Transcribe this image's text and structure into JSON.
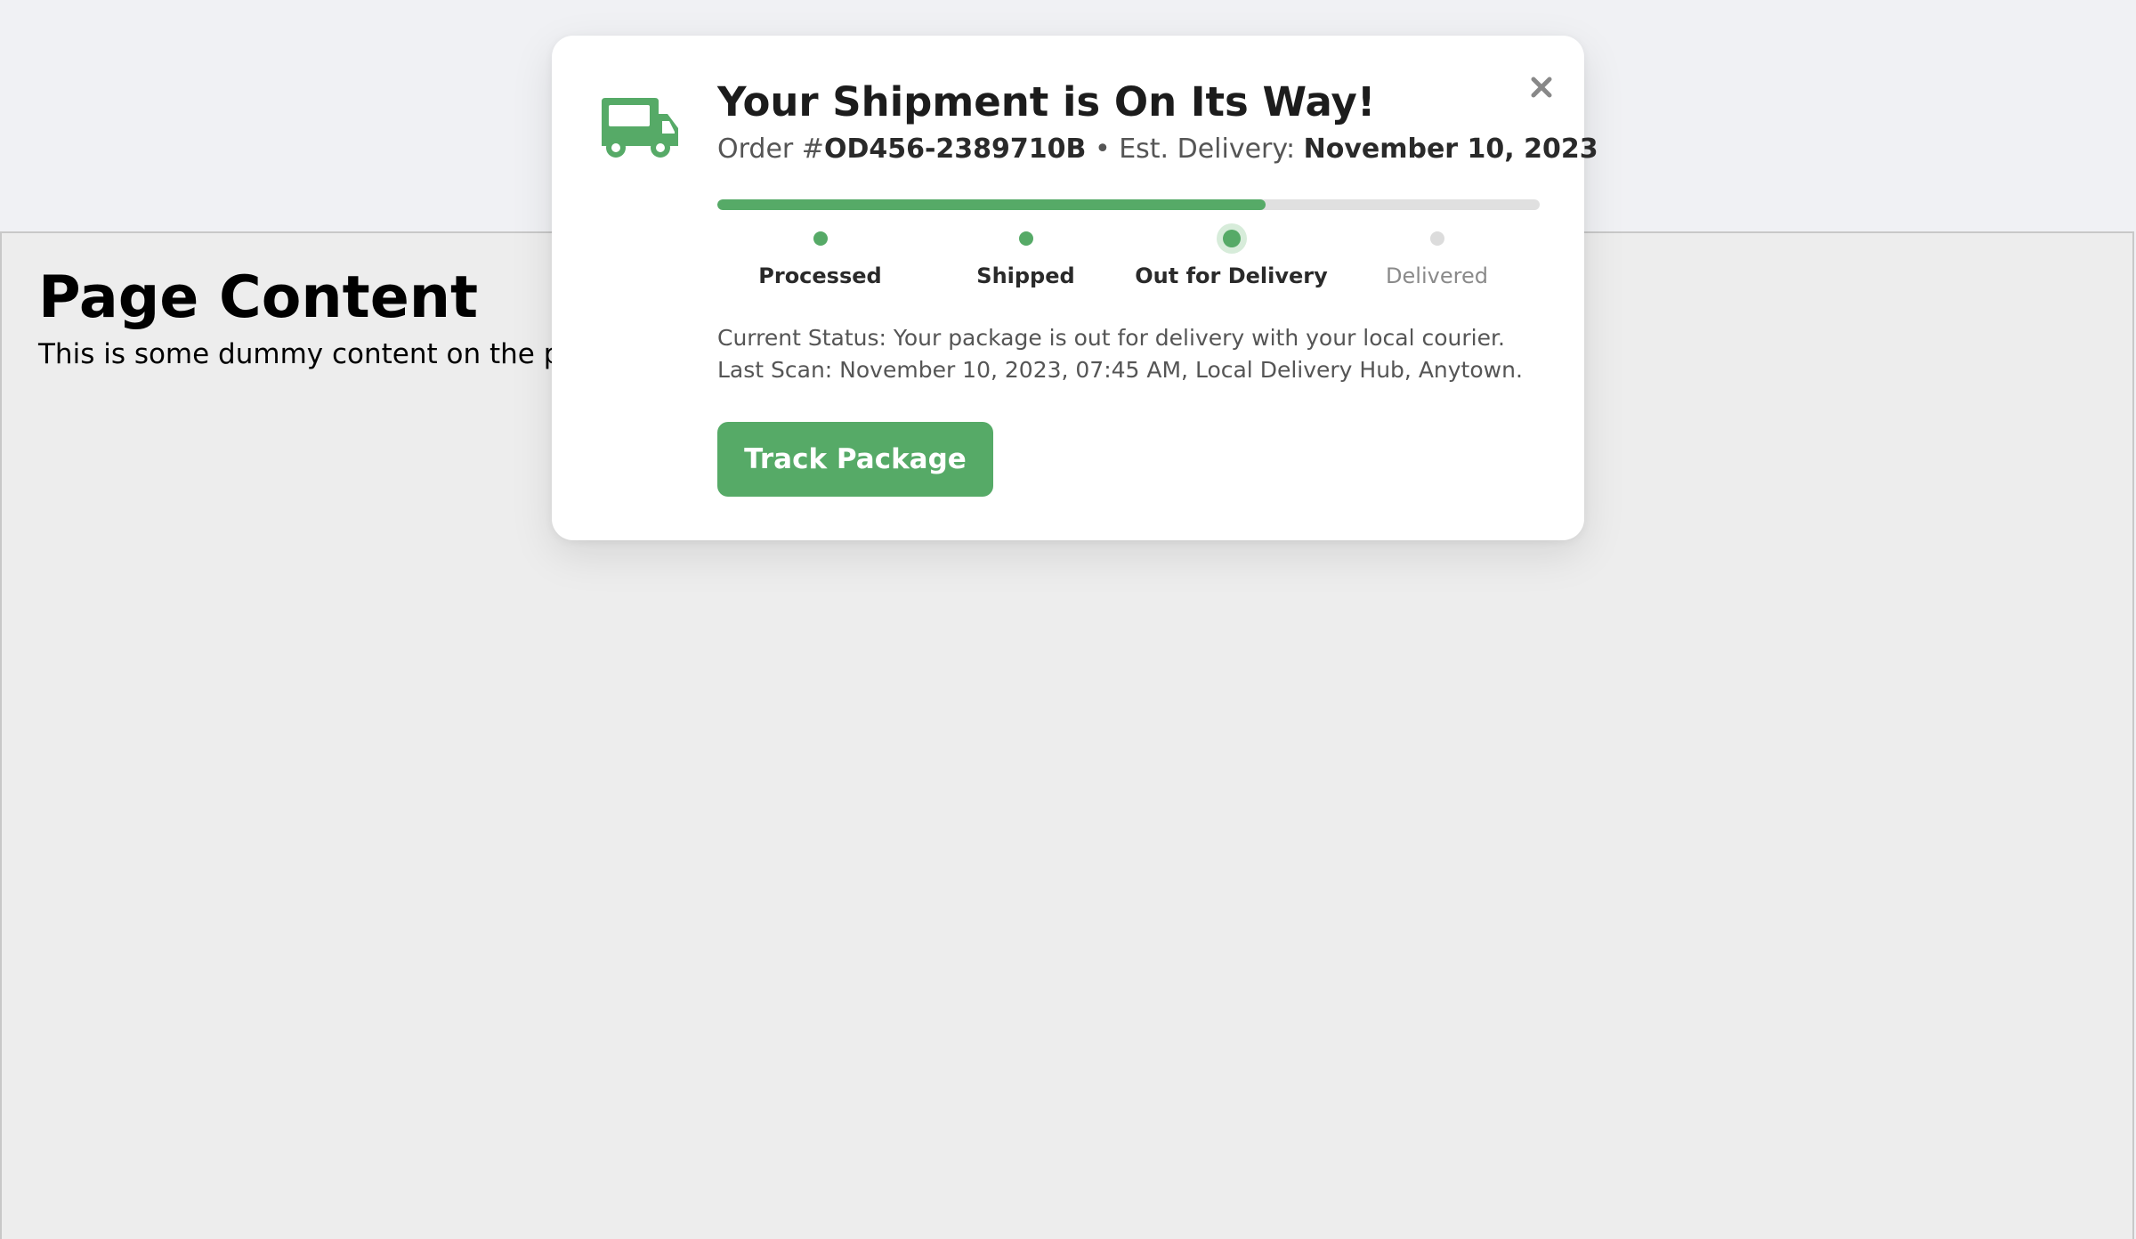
{
  "page": {
    "heading": "Page Content",
    "body_text": "This is some dummy content on the page. Scroll down to see the widget stay in place."
  },
  "widget": {
    "title": "Your Shipment is On Its Way!",
    "order_prefix": "Order #",
    "order_number": "OD456-2389710B",
    "separator": " • ",
    "delivery_label": "Est. Delivery: ",
    "delivery_date": "November 10, 2023",
    "progress_percent": 66.7,
    "steps": [
      {
        "label": "Processed",
        "state": "done"
      },
      {
        "label": "Shipped",
        "state": "done"
      },
      {
        "label": "Out for Delivery",
        "state": "current"
      },
      {
        "label": "Delivered",
        "state": "pending"
      }
    ],
    "current_status": "Current Status: Your package is out for delivery with your local courier.",
    "last_scan": "Last Scan: November 10, 2023, 07:45 AM, Local Delivery Hub, Anytown.",
    "track_button": "Track Package",
    "close_icon": "close-icon",
    "truck_icon": "truck-icon"
  },
  "colors": {
    "accent": "#56aa67",
    "track": "#e0e0e0",
    "page_bg": "#ededed"
  }
}
